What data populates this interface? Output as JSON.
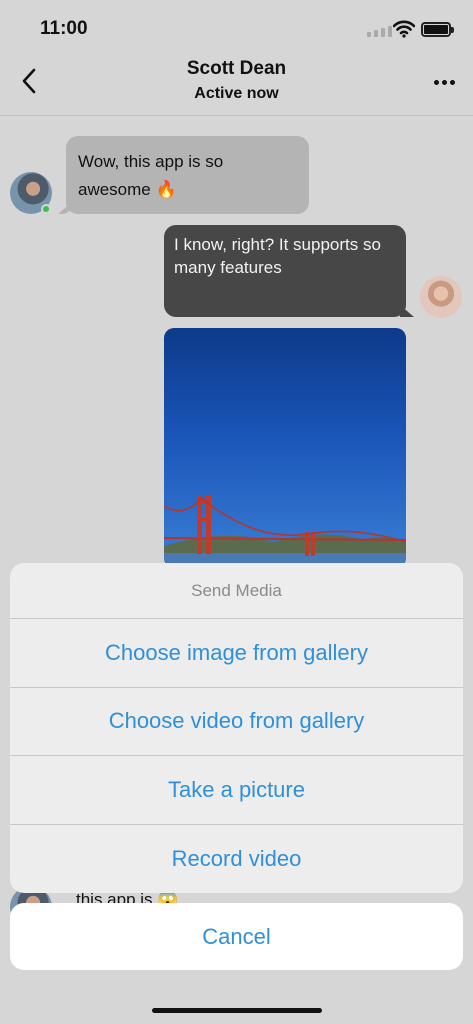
{
  "status_bar": {
    "time": "11:00"
  },
  "header": {
    "title": "Scott Dean",
    "subtitle": "Active now"
  },
  "messages": {
    "incoming_1_line1": "Wow, this app is so",
    "incoming_1_line2": "awesome 🔥",
    "outgoing_1": "I know, right? It supports so many features",
    "partial_text": "this app is 😱"
  },
  "action_sheet": {
    "title": "Send Media",
    "options": [
      {
        "label": "Choose image from gallery"
      },
      {
        "label": "Choose video from gallery"
      },
      {
        "label": "Take a picture"
      },
      {
        "label": "Record video"
      }
    ],
    "cancel_label": "Cancel"
  },
  "colors": {
    "accent": "#2f8fd8",
    "online": "#3cbf52",
    "outgoing_bubble": "#474747",
    "incoming_bubble": "#b4b4b4"
  }
}
